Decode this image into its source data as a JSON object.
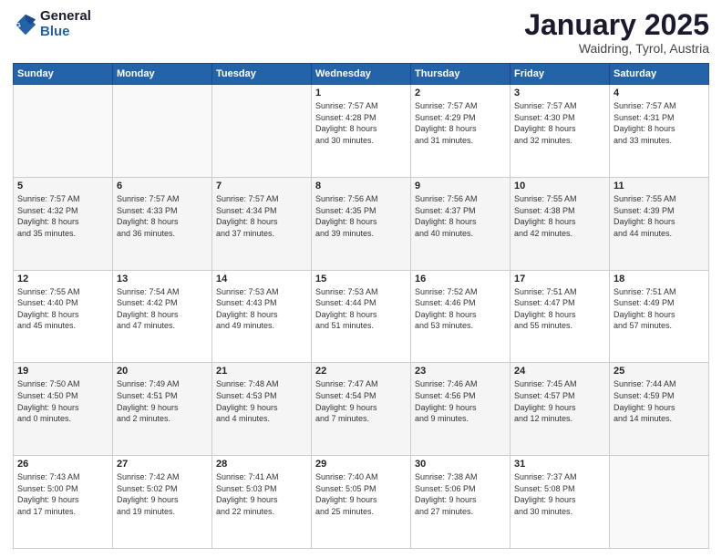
{
  "header": {
    "logo_line1": "General",
    "logo_line2": "Blue",
    "title": "January 2025",
    "subtitle": "Waidring, Tyrol, Austria"
  },
  "days_of_week": [
    "Sunday",
    "Monday",
    "Tuesday",
    "Wednesday",
    "Thursday",
    "Friday",
    "Saturday"
  ],
  "weeks": [
    [
      {
        "day": "",
        "info": ""
      },
      {
        "day": "",
        "info": ""
      },
      {
        "day": "",
        "info": ""
      },
      {
        "day": "1",
        "info": "Sunrise: 7:57 AM\nSunset: 4:28 PM\nDaylight: 8 hours\nand 30 minutes."
      },
      {
        "day": "2",
        "info": "Sunrise: 7:57 AM\nSunset: 4:29 PM\nDaylight: 8 hours\nand 31 minutes."
      },
      {
        "day": "3",
        "info": "Sunrise: 7:57 AM\nSunset: 4:30 PM\nDaylight: 8 hours\nand 32 minutes."
      },
      {
        "day": "4",
        "info": "Sunrise: 7:57 AM\nSunset: 4:31 PM\nDaylight: 8 hours\nand 33 minutes."
      }
    ],
    [
      {
        "day": "5",
        "info": "Sunrise: 7:57 AM\nSunset: 4:32 PM\nDaylight: 8 hours\nand 35 minutes."
      },
      {
        "day": "6",
        "info": "Sunrise: 7:57 AM\nSunset: 4:33 PM\nDaylight: 8 hours\nand 36 minutes."
      },
      {
        "day": "7",
        "info": "Sunrise: 7:57 AM\nSunset: 4:34 PM\nDaylight: 8 hours\nand 37 minutes."
      },
      {
        "day": "8",
        "info": "Sunrise: 7:56 AM\nSunset: 4:35 PM\nDaylight: 8 hours\nand 39 minutes."
      },
      {
        "day": "9",
        "info": "Sunrise: 7:56 AM\nSunset: 4:37 PM\nDaylight: 8 hours\nand 40 minutes."
      },
      {
        "day": "10",
        "info": "Sunrise: 7:55 AM\nSunset: 4:38 PM\nDaylight: 8 hours\nand 42 minutes."
      },
      {
        "day": "11",
        "info": "Sunrise: 7:55 AM\nSunset: 4:39 PM\nDaylight: 8 hours\nand 44 minutes."
      }
    ],
    [
      {
        "day": "12",
        "info": "Sunrise: 7:55 AM\nSunset: 4:40 PM\nDaylight: 8 hours\nand 45 minutes."
      },
      {
        "day": "13",
        "info": "Sunrise: 7:54 AM\nSunset: 4:42 PM\nDaylight: 8 hours\nand 47 minutes."
      },
      {
        "day": "14",
        "info": "Sunrise: 7:53 AM\nSunset: 4:43 PM\nDaylight: 8 hours\nand 49 minutes."
      },
      {
        "day": "15",
        "info": "Sunrise: 7:53 AM\nSunset: 4:44 PM\nDaylight: 8 hours\nand 51 minutes."
      },
      {
        "day": "16",
        "info": "Sunrise: 7:52 AM\nSunset: 4:46 PM\nDaylight: 8 hours\nand 53 minutes."
      },
      {
        "day": "17",
        "info": "Sunrise: 7:51 AM\nSunset: 4:47 PM\nDaylight: 8 hours\nand 55 minutes."
      },
      {
        "day": "18",
        "info": "Sunrise: 7:51 AM\nSunset: 4:49 PM\nDaylight: 8 hours\nand 57 minutes."
      }
    ],
    [
      {
        "day": "19",
        "info": "Sunrise: 7:50 AM\nSunset: 4:50 PM\nDaylight: 9 hours\nand 0 minutes."
      },
      {
        "day": "20",
        "info": "Sunrise: 7:49 AM\nSunset: 4:51 PM\nDaylight: 9 hours\nand 2 minutes."
      },
      {
        "day": "21",
        "info": "Sunrise: 7:48 AM\nSunset: 4:53 PM\nDaylight: 9 hours\nand 4 minutes."
      },
      {
        "day": "22",
        "info": "Sunrise: 7:47 AM\nSunset: 4:54 PM\nDaylight: 9 hours\nand 7 minutes."
      },
      {
        "day": "23",
        "info": "Sunrise: 7:46 AM\nSunset: 4:56 PM\nDaylight: 9 hours\nand 9 minutes."
      },
      {
        "day": "24",
        "info": "Sunrise: 7:45 AM\nSunset: 4:57 PM\nDaylight: 9 hours\nand 12 minutes."
      },
      {
        "day": "25",
        "info": "Sunrise: 7:44 AM\nSunset: 4:59 PM\nDaylight: 9 hours\nand 14 minutes."
      }
    ],
    [
      {
        "day": "26",
        "info": "Sunrise: 7:43 AM\nSunset: 5:00 PM\nDaylight: 9 hours\nand 17 minutes."
      },
      {
        "day": "27",
        "info": "Sunrise: 7:42 AM\nSunset: 5:02 PM\nDaylight: 9 hours\nand 19 minutes."
      },
      {
        "day": "28",
        "info": "Sunrise: 7:41 AM\nSunset: 5:03 PM\nDaylight: 9 hours\nand 22 minutes."
      },
      {
        "day": "29",
        "info": "Sunrise: 7:40 AM\nSunset: 5:05 PM\nDaylight: 9 hours\nand 25 minutes."
      },
      {
        "day": "30",
        "info": "Sunrise: 7:38 AM\nSunset: 5:06 PM\nDaylight: 9 hours\nand 27 minutes."
      },
      {
        "day": "31",
        "info": "Sunrise: 7:37 AM\nSunset: 5:08 PM\nDaylight: 9 hours\nand 30 minutes."
      },
      {
        "day": "",
        "info": ""
      }
    ]
  ]
}
